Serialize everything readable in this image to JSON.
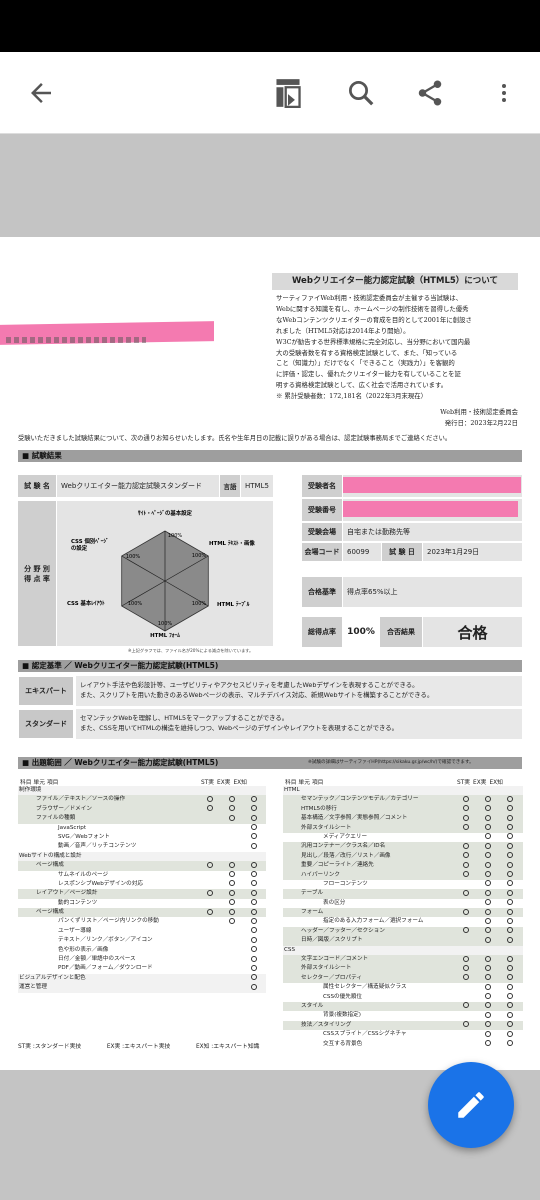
{
  "notice": {
    "title": "Webクリエイター能力認定試験（HTML5）について",
    "lines": [
      "サーティファイWeb利用・技術認定委員会が主催する当試験は、",
      "Webに関する知識を有し、ホームページの制作技術を習得した優秀",
      "なWebコンテンツクリエイターの育成を目的として2001年に創設さ",
      "れました（HTML5対応は2014年より開始）。",
      "W3Cが勧告する世界標準規格に完全対応し、当分野において国内最",
      "大の受験者数を有する資格検定試験として、また、「知っている",
      "こと（知識力）」だけでなく「できること（実践力）」を客観的",
      "に評価・認定し、優れたクリエイター能力を有していることを証",
      "明する資格検定試験として、広く社会で活用されています。",
      "※ 累計受験者数：172,181名（2022年3月末現在）"
    ],
    "org": "Web利用・技術認定委員会",
    "issued": "発行日：2023年2月22日"
  },
  "intro": "受験いただきました試験結果について、次の通りお知らせいたします。氏名や生年月日の記載に誤りがある場合は、認定試験事務局までご連絡ください。",
  "results": {
    "section": "■ 試験結果",
    "exam_name_label": "試 験 名",
    "exam_name": "Webクリエイター能力認定試験スタンダード",
    "lang_label": "言語",
    "lang": "HTML5",
    "score_label": "分 野 別\n得 点 率",
    "radar_axes": [
      "ｻｲﾄ・ﾍﾟｰｼﾞの基本設定",
      "HTML ﾃｷｽﾄ・画像",
      "HTML ﾃｰﾌﾞﾙ",
      "HTML ﾌｫｰﾑ",
      "CSS 基本ﾚｲｱｳﾄ",
      "CSS 個別ﾍﾟｰｼﾞ\nの設定"
    ],
    "radar_values": [
      "100%",
      "100%",
      "100%",
      "100%",
      "100%",
      "100%"
    ],
    "radar_note": "※上記グラフでは、ファイル名が20%による減点を除いています。",
    "candidate_name_label": "受験者名",
    "candidate_number_label": "受験番号",
    "venue_label": "受験会場",
    "venue": "自宅または勤務先等",
    "venue_code_label": "会場コード",
    "venue_code": "60099",
    "exam_date_label": "試 験 日",
    "exam_date": "2023年1月29日",
    "pass_criteria_label": "合格基準",
    "pass_criteria": "得点率65%以上",
    "total_label": "総得点率",
    "total": "100%",
    "result_label": "合否結果",
    "result": "合格"
  },
  "criteria": {
    "section": "■ 認定基準 ／ Webクリエイター能力認定試験(HTML5)",
    "expert_label": "エキスパート",
    "expert_lines": [
      "レイアウト手法や色彩設計等、ユーザビリティやアクセスビリティを考慮したWebデザインを表現することができる。",
      "また、スクリプトを用いた動きのあるWebページの表示、マルチデバイス対応、新規Webサイトを構築することができる。"
    ],
    "standard_label": "スタンダード",
    "standard_lines": [
      "セマンテックWebを理解し、HTML5をマークアップすることができる。",
      "また、CSSを用いてHTMLの構造を維持しつつ、Webページのデザインやレイアウトを表現することができる。"
    ]
  },
  "syllabus": {
    "section": "■ 出題範囲 ／ Webクリエイター能力認定試験(HTML5)",
    "note": "※試験の詳細はサーティファイHP(https://sikaku.gr.jp/wc/h/)で確認できます。",
    "head": [
      "科目 単元 項目",
      "ST実",
      "EX実",
      "EX知"
    ],
    "left": [
      {
        "t": "制作環境",
        "lv": 0,
        "m": [
          0,
          0,
          0
        ]
      },
      {
        "t": "ファイル／テキスト／ソースの操作",
        "lv": 1,
        "m": [
          1,
          1,
          1
        ]
      },
      {
        "t": "ブラウザー／ドメイン",
        "lv": 1,
        "m": [
          1,
          1,
          1
        ]
      },
      {
        "t": "ファイルの種類",
        "lv": 1,
        "m": [
          0,
          1,
          1
        ]
      },
      {
        "t": "JavaScript",
        "lv": 2,
        "m": [
          0,
          0,
          1
        ]
      },
      {
        "t": "SVG／Webフォント",
        "lv": 2,
        "m": [
          0,
          0,
          1
        ]
      },
      {
        "t": "動画／音声／リッチコンテンツ",
        "lv": 2,
        "m": [
          0,
          0,
          1
        ]
      },
      {
        "t": "Webサイトの構成と設計",
        "lv": 0,
        "m": [
          0,
          0,
          0
        ]
      },
      {
        "t": "ページ構成",
        "lv": 1,
        "m": [
          1,
          1,
          1
        ]
      },
      {
        "t": "サムネイルのページ",
        "lv": 2,
        "m": [
          0,
          1,
          1
        ]
      },
      {
        "t": "レスポンシブWebデザインの対応",
        "lv": 2,
        "m": [
          0,
          1,
          1
        ]
      },
      {
        "t": "レイアウト／ページ設計",
        "lv": 1,
        "m": [
          1,
          1,
          1
        ]
      },
      {
        "t": "動的コンテンツ",
        "lv": 2,
        "m": [
          0,
          1,
          1
        ]
      },
      {
        "t": "ページ構成",
        "lv": 1,
        "m": [
          1,
          1,
          1
        ]
      },
      {
        "t": "パンくずリスト／ページ内リンクの移動",
        "lv": 2,
        "m": [
          0,
          1,
          1
        ]
      },
      {
        "t": "ユーザー導線",
        "lv": 2,
        "m": [
          0,
          0,
          1
        ]
      },
      {
        "t": "テキスト／リンク／ボタン／アイコン",
        "lv": 2,
        "m": [
          0,
          0,
          1
        ]
      },
      {
        "t": "色や形の表示／画像",
        "lv": 2,
        "m": [
          0,
          0,
          1
        ]
      },
      {
        "t": "日付／金額／単語中のスペース",
        "lv": 2,
        "m": [
          0,
          0,
          1
        ]
      },
      {
        "t": "PDF／動画／フォーム／ダウンロード",
        "lv": 2,
        "m": [
          0,
          0,
          1
        ]
      },
      {
        "t": "ビジュアルデザインと配色",
        "lv": 0,
        "m": [
          0,
          0,
          1
        ]
      },
      {
        "t": "運営と管理",
        "lv": 0,
        "m": [
          0,
          0,
          1
        ]
      }
    ],
    "right": [
      {
        "t": "HTML",
        "lv": 0,
        "m": [
          0,
          0,
          0
        ]
      },
      {
        "t": "セマンテック／コンテンツモデル／カテゴリー",
        "lv": 1,
        "m": [
          1,
          1,
          1
        ]
      },
      {
        "t": "HTML5の移行",
        "lv": 1,
        "m": [
          1,
          1,
          1
        ]
      },
      {
        "t": "基本構造／文字参照／実態参照／コメント",
        "lv": 1,
        "m": [
          1,
          1,
          1
        ]
      },
      {
        "t": "外部スタイルシート",
        "lv": 1,
        "m": [
          1,
          1,
          1
        ]
      },
      {
        "t": "メディアクエリー",
        "lv": 2,
        "m": [
          0,
          1,
          1
        ]
      },
      {
        "t": "汎用コンテナー／クラス名／ID名",
        "lv": 1,
        "m": [
          1,
          1,
          1
        ]
      },
      {
        "t": "見出し／段落／改行／リスト／画像",
        "lv": 1,
        "m": [
          1,
          1,
          1
        ]
      },
      {
        "t": "重要／コピーライト／連絡先",
        "lv": 1,
        "m": [
          1,
          1,
          1
        ]
      },
      {
        "t": "ハイパーリンク",
        "lv": 1,
        "m": [
          1,
          1,
          1
        ]
      },
      {
        "t": "フローコンテンツ",
        "lv": 2,
        "m": [
          0,
          1,
          1
        ]
      },
      {
        "t": "テーブル",
        "lv": 1,
        "m": [
          1,
          1,
          1
        ]
      },
      {
        "t": "表の区分",
        "lv": 2,
        "m": [
          0,
          1,
          1
        ]
      },
      {
        "t": "フォーム",
        "lv": 1,
        "m": [
          1,
          1,
          1
        ]
      },
      {
        "t": "指定のある入力フォーム／選択フォーム",
        "lv": 2,
        "m": [
          0,
          1,
          1
        ]
      },
      {
        "t": "ヘッダー／フッター／セクション",
        "lv": 1,
        "m": [
          1,
          1,
          1
        ]
      },
      {
        "t": "日時／図版／スクリプト",
        "lv": 1,
        "m": [
          0,
          1,
          1
        ]
      },
      {
        "t": "CSS",
        "lv": 0,
        "m": [
          0,
          0,
          0
        ]
      },
      {
        "t": "文字エンコード／コメント",
        "lv": 1,
        "m": [
          1,
          1,
          1
        ]
      },
      {
        "t": "外部スタイルシート",
        "lv": 1,
        "m": [
          1,
          1,
          1
        ]
      },
      {
        "t": "セレクター／プロパティ",
        "lv": 1,
        "m": [
          1,
          1,
          1
        ]
      },
      {
        "t": "属性セレクター／構造疑似クラス",
        "lv": 2,
        "m": [
          0,
          1,
          1
        ]
      },
      {
        "t": "CSSの優先順位",
        "lv": 2,
        "m": [
          0,
          1,
          1
        ]
      },
      {
        "t": "スタイル",
        "lv": 1,
        "m": [
          1,
          1,
          1
        ]
      },
      {
        "t": "背景(複数指定)",
        "lv": 2,
        "m": [
          0,
          1,
          1
        ]
      },
      {
        "t": "技法／スタイリング",
        "lv": 1,
        "m": [
          1,
          1,
          1
        ]
      },
      {
        "t": "CSSスプライト／CSSシグネチャ",
        "lv": 2,
        "m": [
          0,
          1,
          1
        ]
      },
      {
        "t": "交互する背景色",
        "lv": 2,
        "m": [
          0,
          1,
          1
        ]
      }
    ],
    "legend": [
      "ST実 :スタンダード実技",
      "EX実 :エキスパート実技",
      "EX知 :エキスパート知識"
    ]
  },
  "icons": [
    "back-arrow-icon",
    "layout-icon",
    "search-icon",
    "share-icon",
    "more-vert-icon",
    "edit-pencil-icon"
  ]
}
